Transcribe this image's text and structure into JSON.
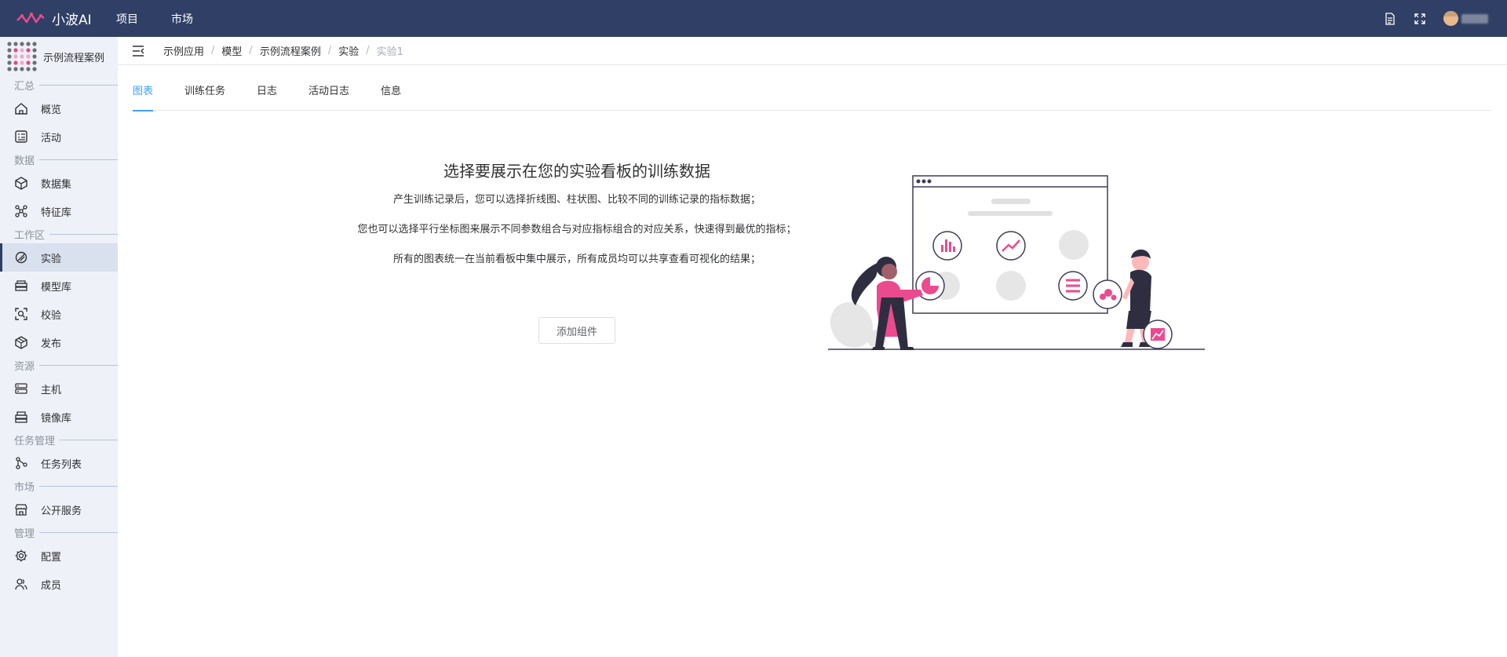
{
  "app": {
    "name": "小波AI"
  },
  "topnav": {
    "items": [
      "项目",
      "市场"
    ]
  },
  "sidebar": {
    "project_name": "示例流程案例",
    "sections": [
      {
        "label": "汇总",
        "items": [
          {
            "label": "概览",
            "icon": "home-icon"
          },
          {
            "label": "活动",
            "icon": "activity-icon"
          }
        ]
      },
      {
        "label": "数据",
        "items": [
          {
            "label": "数据集",
            "icon": "cube-icon"
          },
          {
            "label": "特征库",
            "icon": "nodes-icon"
          }
        ]
      },
      {
        "label": "工作区",
        "items": [
          {
            "label": "实验",
            "icon": "flask-icon",
            "active": true
          },
          {
            "label": "模型库",
            "icon": "stack-icon"
          },
          {
            "label": "校验",
            "icon": "scan-icon"
          },
          {
            "label": "发布",
            "icon": "box-icon"
          }
        ]
      },
      {
        "label": "资源",
        "items": [
          {
            "label": "主机",
            "icon": "server-icon"
          },
          {
            "label": "镜像库",
            "icon": "image-stack-icon"
          }
        ]
      },
      {
        "label": "任务管理",
        "items": [
          {
            "label": "任务列表",
            "icon": "share-icon"
          }
        ]
      },
      {
        "label": "市场",
        "items": [
          {
            "label": "公开服务",
            "icon": "store-icon"
          }
        ]
      },
      {
        "label": "管理",
        "items": [
          {
            "label": "配置",
            "icon": "gear-icon"
          },
          {
            "label": "成员",
            "icon": "users-icon"
          }
        ]
      }
    ]
  },
  "breadcrumb": [
    "示例应用",
    "模型",
    "示例流程案例",
    "实验",
    "实验1"
  ],
  "tabs": [
    "图表",
    "训练任务",
    "日志",
    "活动日志",
    "信息"
  ],
  "active_tab": "图表",
  "empty_state": {
    "title": "选择要展示在您的实验看板的训练数据",
    "lines": [
      "产生训练记录后，您可以选择折线图、柱状图、比较不同的训练记录的指标数据；",
      "您也可以选择平行坐标图来展示不同参数组合与对应指标组合的对应关系，快速得到最优的指标；",
      "所有的图表统一在当前看板中集中展示，所有成员均可以共享查看可视化的结果；"
    ],
    "add_button": "添加组件"
  },
  "colors": {
    "topbar": "#2f3f66",
    "accent": "#409eff",
    "sidebar": "#eef1f7",
    "illustration_pink": "#ec4a8e"
  }
}
